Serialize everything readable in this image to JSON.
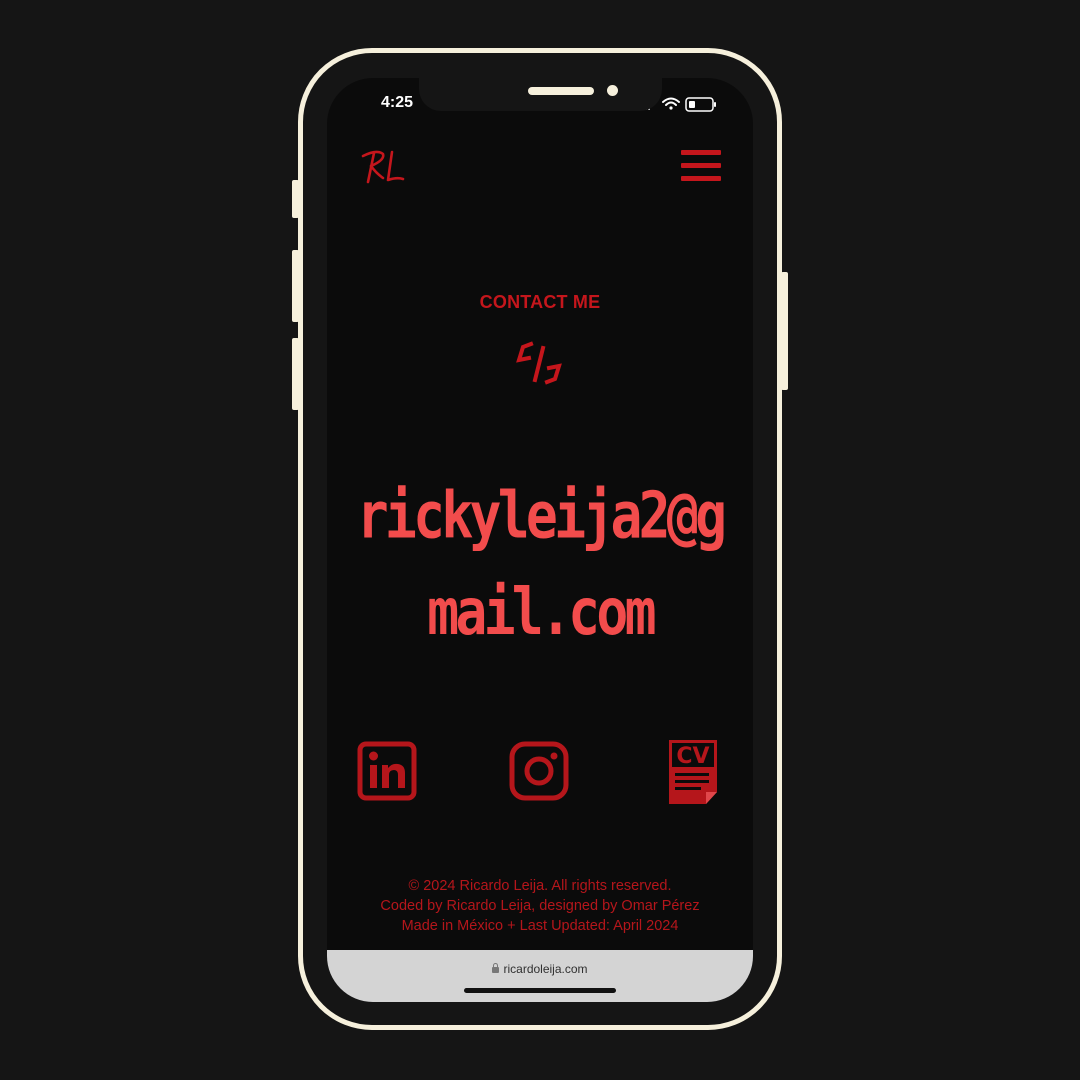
{
  "status_bar": {
    "time": "4:25",
    "icons": [
      "cellular-icon",
      "wifi-icon",
      "battery-icon"
    ]
  },
  "header": {
    "logo_text": "RL",
    "menu_icon": "hamburger-menu-icon"
  },
  "main": {
    "section_title": "CONTACT ME",
    "divider_icon": "code-brackets-icon",
    "email_line1": "rickyleija2@g",
    "email_line2": "mail.com"
  },
  "social_links": [
    {
      "name": "linkedin",
      "icon": "linkedin-icon"
    },
    {
      "name": "instagram",
      "icon": "instagram-icon"
    },
    {
      "name": "cv",
      "icon": "cv-document-icon",
      "label": "CV"
    }
  ],
  "footer": {
    "line1": "© 2024 Ricardo Leija. All rights reserved.",
    "line2": "Coded by Ricardo Leija, designed by Omar Pérez",
    "line3": "Made in México + Last Updated: April 2024"
  },
  "browser": {
    "url": "ricardoleija.com"
  },
  "colors": {
    "background": "#151515",
    "frame": "#f6f0dc",
    "screen": "#0b0b0b",
    "accent_dark_red": "#b5161b",
    "email_red": "#f24c4c",
    "url_bar": "#d4d4d4"
  }
}
